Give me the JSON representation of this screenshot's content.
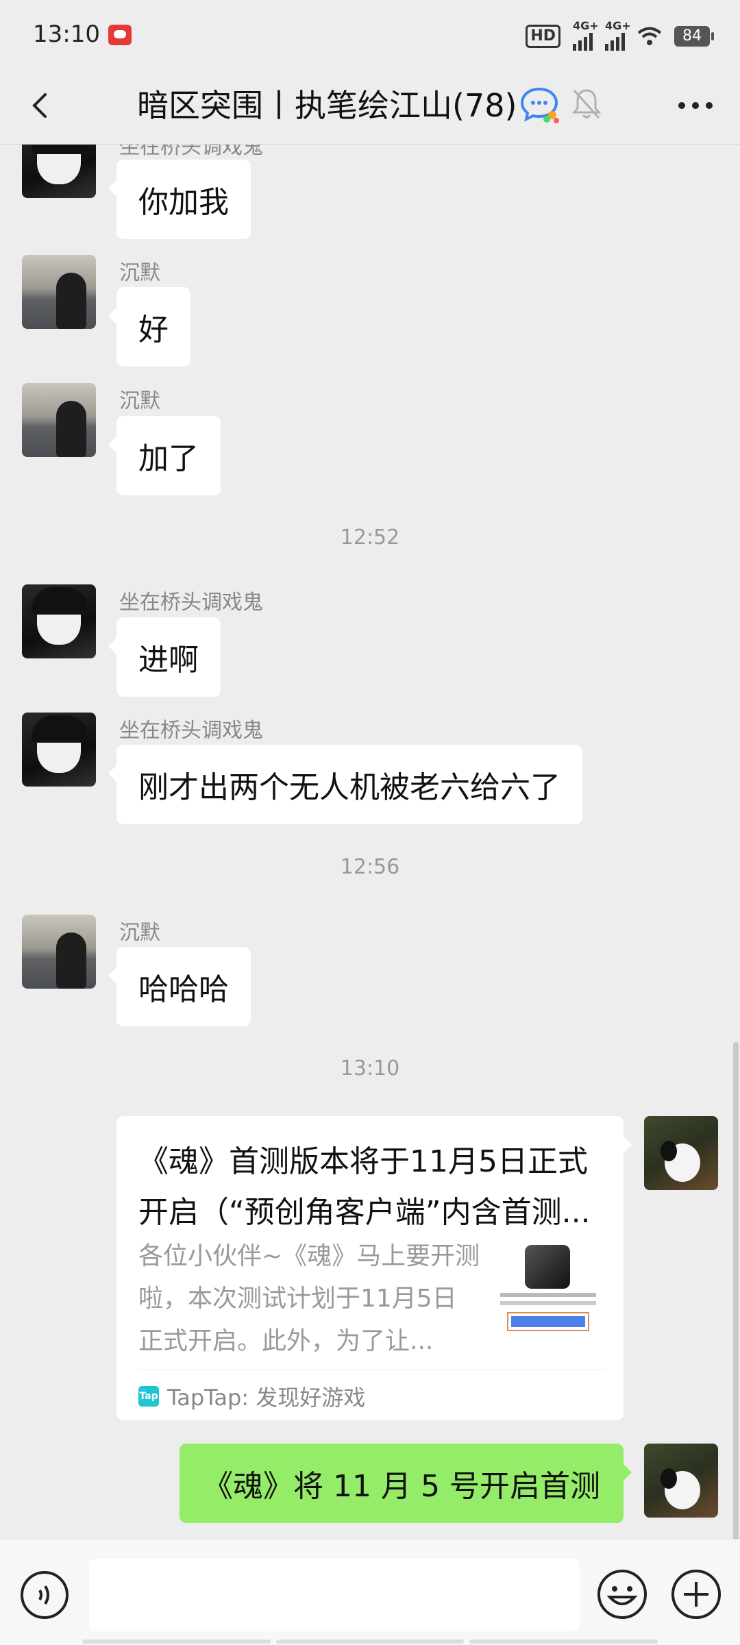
{
  "status_bar": {
    "time": "13:10",
    "hd": "HD",
    "network1": "4G+",
    "network2": "4G+",
    "battery": "84"
  },
  "header": {
    "title": "暗区突围丨执笔绘江山",
    "count": "(78)"
  },
  "messages": [
    {
      "sender": "坐在桥头调戏鬼",
      "text": "你加我",
      "side": "left",
      "avatar": "anime-avatar"
    },
    {
      "sender": "沉默",
      "text": "好",
      "side": "left",
      "avatar": "lake-avatar"
    },
    {
      "sender": "沉默",
      "text": "加了",
      "side": "left",
      "avatar": "lake-avatar"
    },
    {
      "timestamp": "12:52"
    },
    {
      "sender": "坐在桥头调戏鬼",
      "text": "进啊",
      "side": "left",
      "avatar": "anime-avatar"
    },
    {
      "sender": "坐在桥头调戏鬼",
      "text": "刚才出两个无人机被老六给六了",
      "side": "left",
      "avatar": "anime-avatar"
    },
    {
      "timestamp": "12:56"
    },
    {
      "sender": "沉默",
      "text": "哈哈哈",
      "side": "left",
      "avatar": "lake-avatar"
    },
    {
      "timestamp": "13:10"
    }
  ],
  "link_card": {
    "title": "《魂》首测版本将于11月5日正式开启（“预创角客户端”内含首测...",
    "description": "各位小伙伴~《魂》马上要开测啦，本次测试计划于11月5日正式开启。此外，为了让...",
    "source": "TapTap: 发现好游戏",
    "source_icon": "Tap"
  },
  "my_message": {
    "text": "《魂》将 11 月 5 号开启首测"
  },
  "input": {
    "value": ""
  },
  "colors": {
    "background": "#ededed",
    "my_bubble": "#95ec69",
    "other_bubble": "#ffffff",
    "taptap": "#1fc6cf"
  }
}
